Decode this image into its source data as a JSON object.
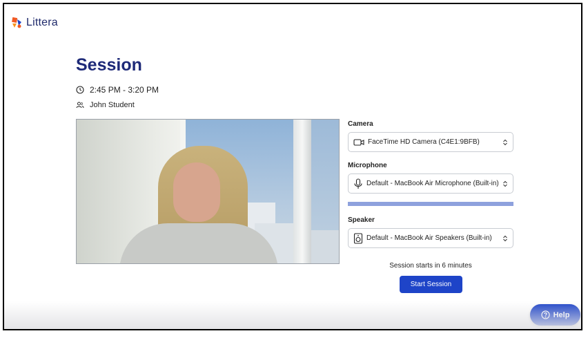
{
  "app": {
    "name": "Littera",
    "brand_color": "#1e44c8",
    "title_color": "#1e2a78"
  },
  "session": {
    "title": "Session",
    "time": "2:45 PM - 3:20 PM",
    "participant": "John Student"
  },
  "devices": {
    "camera": {
      "label": "Camera",
      "value": "FaceTime HD Camera (C4E1:9BFB)",
      "icon": "video-camera-icon"
    },
    "microphone": {
      "label": "Microphone",
      "value": "Default - MacBook Air Microphone (Built-in)",
      "icon": "microphone-icon",
      "level_fraction": 1.0
    },
    "speaker": {
      "label": "Speaker",
      "value": "Default - MacBook Air Speakers (Built-in)",
      "icon": "speaker-icon"
    }
  },
  "footer": {
    "starts_text": "Session starts in 6 minutes",
    "start_button": "Start Session",
    "help_button": "Help"
  }
}
